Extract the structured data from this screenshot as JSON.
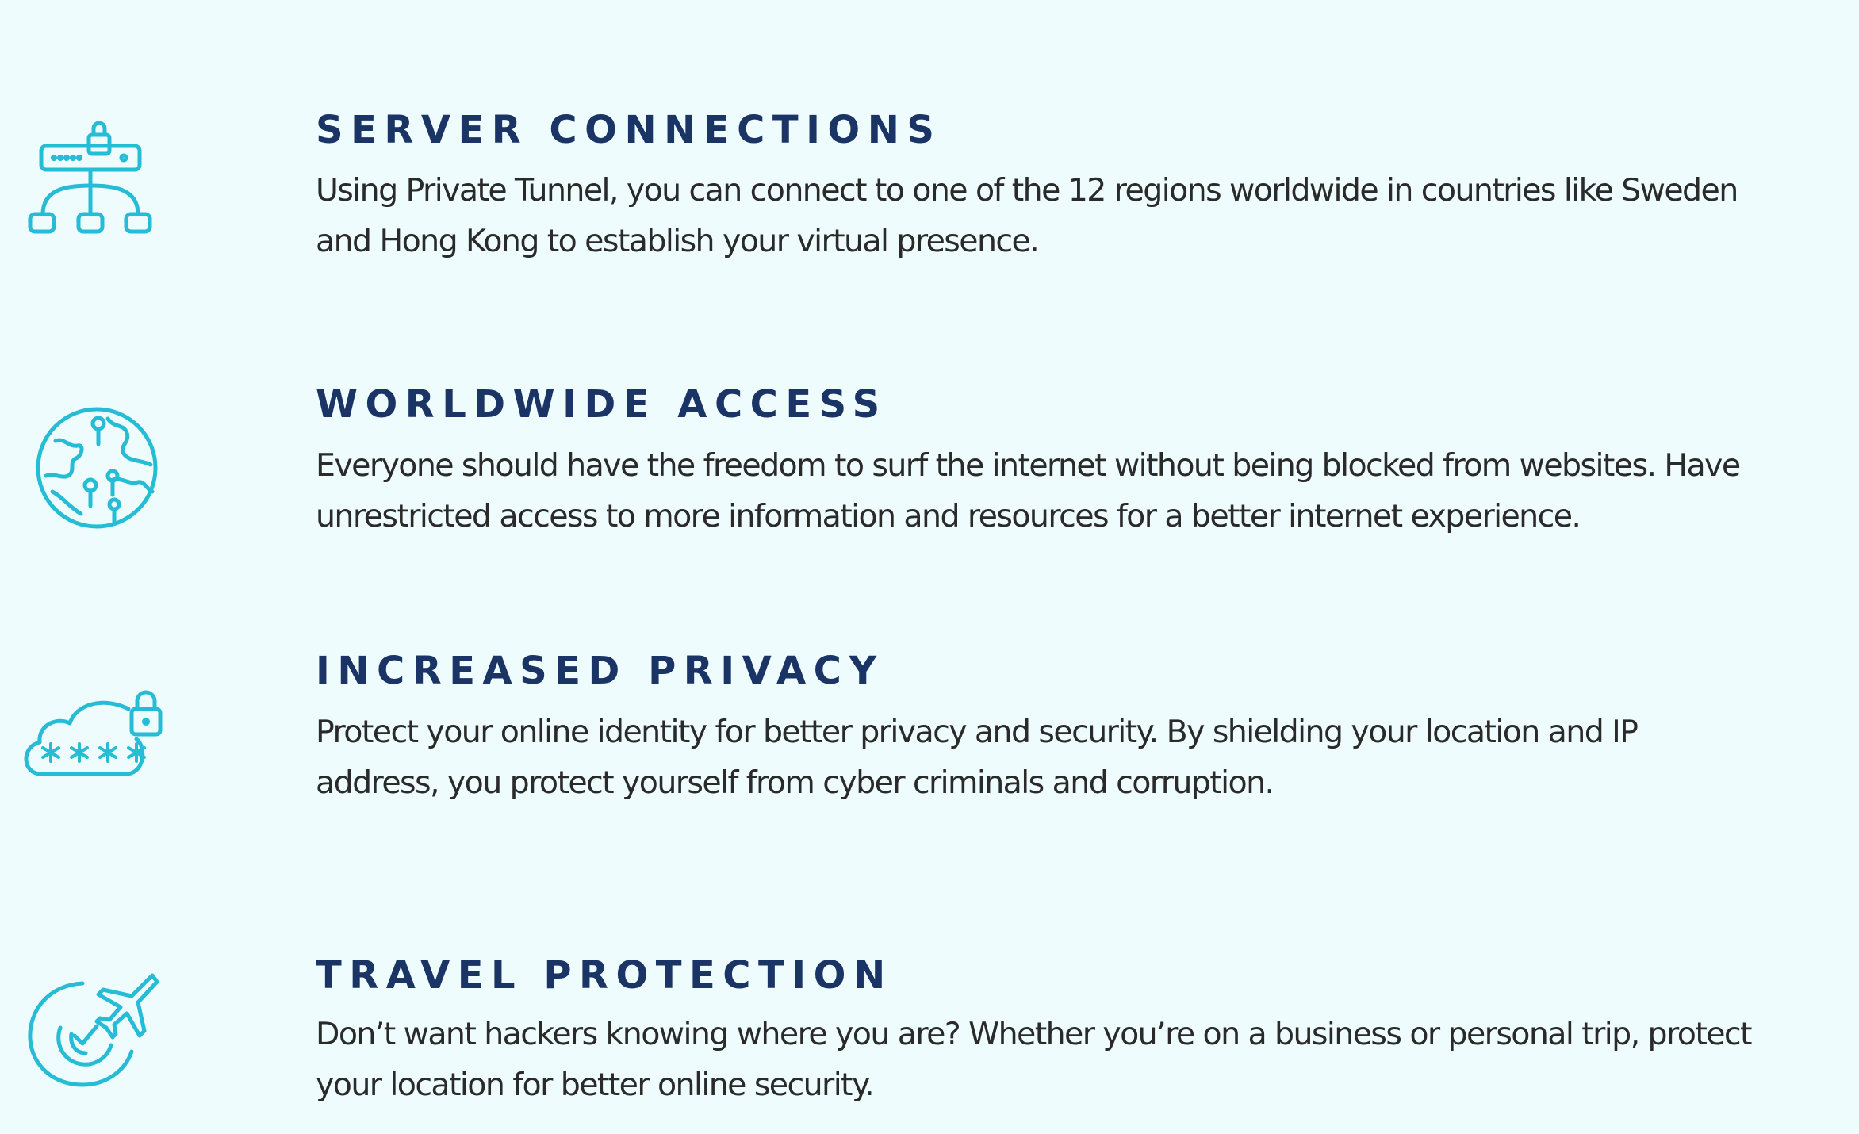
{
  "features": [
    {
      "icon": "network-lock-icon",
      "title": "SERVER CONNECTIONS",
      "description_lines": [
        "Using Private Tunnel, you can connect to one of the 12 regions worldwide in countries like Sweden",
        "and Hong Kong to establish your virtual presence."
      ]
    },
    {
      "icon": "globe-pins-icon",
      "title": "WORLDWIDE ACCESS",
      "description_lines": [
        "Everyone should have the freedom to surf the internet without being blocked from websites. Have",
        "unrestricted access to more information and resources for a better internet experience."
      ]
    },
    {
      "icon": "cloud-password-lock-icon",
      "title": "INCREASED PRIVACY",
      "description_lines": [
        "Protect your online identity for better privacy and security. By shielding your location and IP",
        "address, you protect yourself from cyber criminals and corruption."
      ]
    },
    {
      "icon": "airplane-radar-icon",
      "title": "TRAVEL PROTECTION",
      "description_lines": [
        "Don’t want hackers knowing where you are? Whether you’re on a business or personal trip, protect",
        "your location for better online security."
      ]
    }
  ],
  "colors": {
    "background": "#effcfd",
    "title": "#1b3466",
    "body_text": "#2a2a2a",
    "icon_accent": "#27bcd6"
  }
}
